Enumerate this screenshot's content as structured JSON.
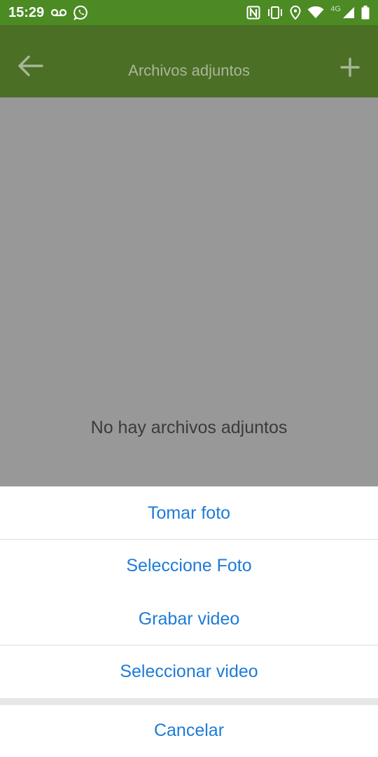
{
  "status_bar": {
    "time": "15:29",
    "network_label": "4G",
    "icons": [
      "voicemail-icon",
      "whatsapp-icon",
      "nfc-icon",
      "vibrate-icon",
      "location-icon",
      "wifi-icon",
      "signal-icon",
      "battery-icon"
    ]
  },
  "app_bar": {
    "title": "Archivos adjuntos",
    "back_icon": "arrow-left-icon",
    "add_icon": "plus-icon",
    "color": "#4b6f25"
  },
  "content": {
    "empty_message": "No hay archivos adjuntos"
  },
  "action_sheet": {
    "options": [
      {
        "label": "Tomar foto"
      },
      {
        "label": "Seleccione Foto"
      },
      {
        "label": "Grabar video"
      },
      {
        "label": "Seleccionar video"
      }
    ],
    "cancel_label": "Cancelar",
    "text_color": "#1e7bd6"
  }
}
